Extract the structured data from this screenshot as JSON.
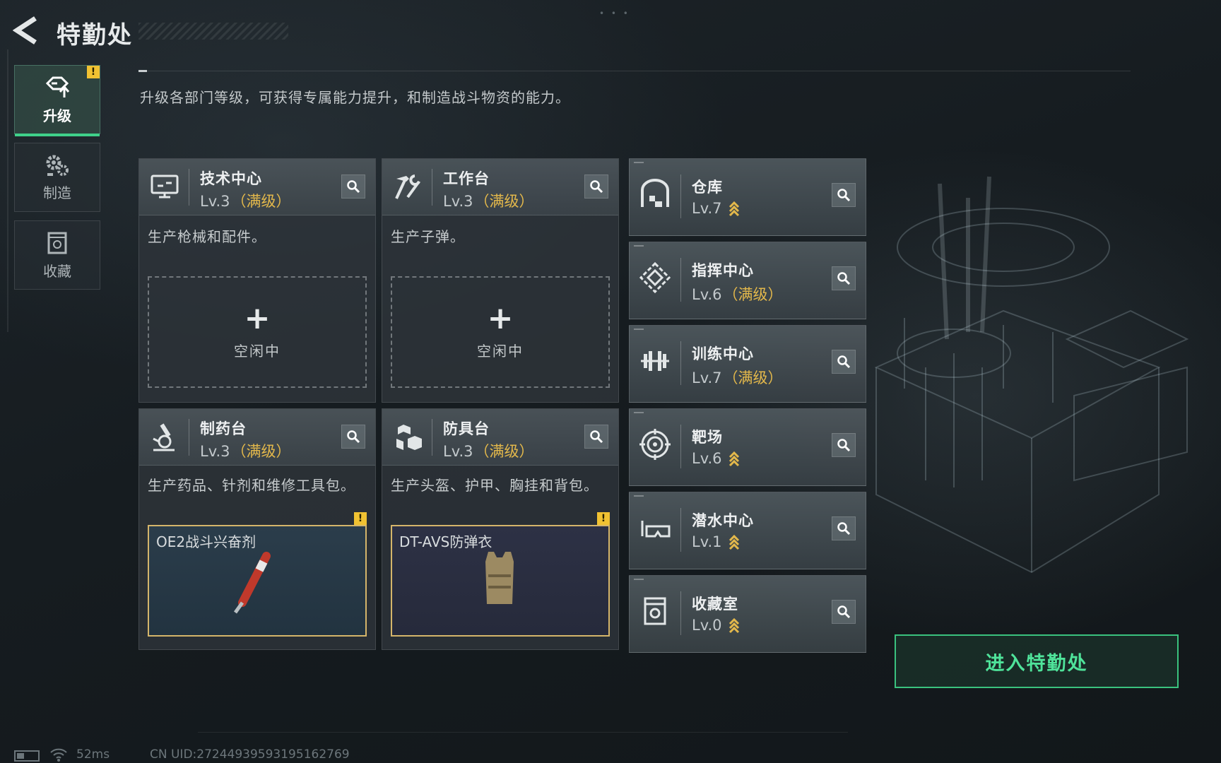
{
  "header": {
    "title": "特勤处"
  },
  "sidebar": {
    "tabs": [
      {
        "label": "升级",
        "alert": "!"
      },
      {
        "label": "制造"
      },
      {
        "label": "收藏"
      }
    ]
  },
  "description": "升级各部门等级，可获得专属能力提升，和制造战斗物资的能力。",
  "workshops": [
    {
      "name": "技术中心",
      "level": "Lv.3",
      "max": "（满级）",
      "text": "生产枪械和配件。",
      "slot_plus": "+",
      "slot_status": "空闲中",
      "icon": "monitor-icon"
    },
    {
      "name": "工作台",
      "level": "Lv.3",
      "max": "（满级）",
      "text": "生产子弹。",
      "slot_plus": "+",
      "slot_status": "空闲中",
      "icon": "hammer-wrench-icon"
    },
    {
      "name": "制药台",
      "level": "Lv.3",
      "max": "（满级）",
      "text": "生产药品、针剂和维修工具包。",
      "item": "OE2战斗兴奋剂",
      "alert": "!",
      "icon": "microscope-icon"
    },
    {
      "name": "防具台",
      "level": "Lv.3",
      "max": "（满级）",
      "text": "生产头盔、护甲、胸挂和背包。",
      "item": "DT-AVS防弹衣",
      "alert": "!",
      "icon": "cubes-icon"
    }
  ],
  "facilities": [
    {
      "name": "仓库",
      "level": "Lv.7",
      "max": "",
      "upgradable": true,
      "icon": "warehouse-icon"
    },
    {
      "name": "指挥中心",
      "level": "Lv.6",
      "max": "（满级）",
      "upgradable": false,
      "icon": "command-diamond-icon"
    },
    {
      "name": "训练中心",
      "level": "Lv.7",
      "max": "（满级）",
      "upgradable": false,
      "icon": "dumbbell-icon"
    },
    {
      "name": "靶场",
      "level": "Lv.6",
      "max": "",
      "upgradable": true,
      "icon": "target-icon"
    },
    {
      "name": "潜水中心",
      "level": "Lv.1",
      "max": "",
      "upgradable": true,
      "icon": "diving-mask-icon"
    },
    {
      "name": "收藏室",
      "level": "Lv.0",
      "max": "",
      "upgradable": true,
      "icon": "collection-icon"
    }
  ],
  "enter_button": "进入特勤处",
  "footer": {
    "ping": "52ms",
    "uid": "CN UID:2724493959319516276​9"
  },
  "colors": {
    "accent_green": "#3ac27e",
    "max_gold": "#e3b84b",
    "alert_yellow": "#f1c232"
  }
}
